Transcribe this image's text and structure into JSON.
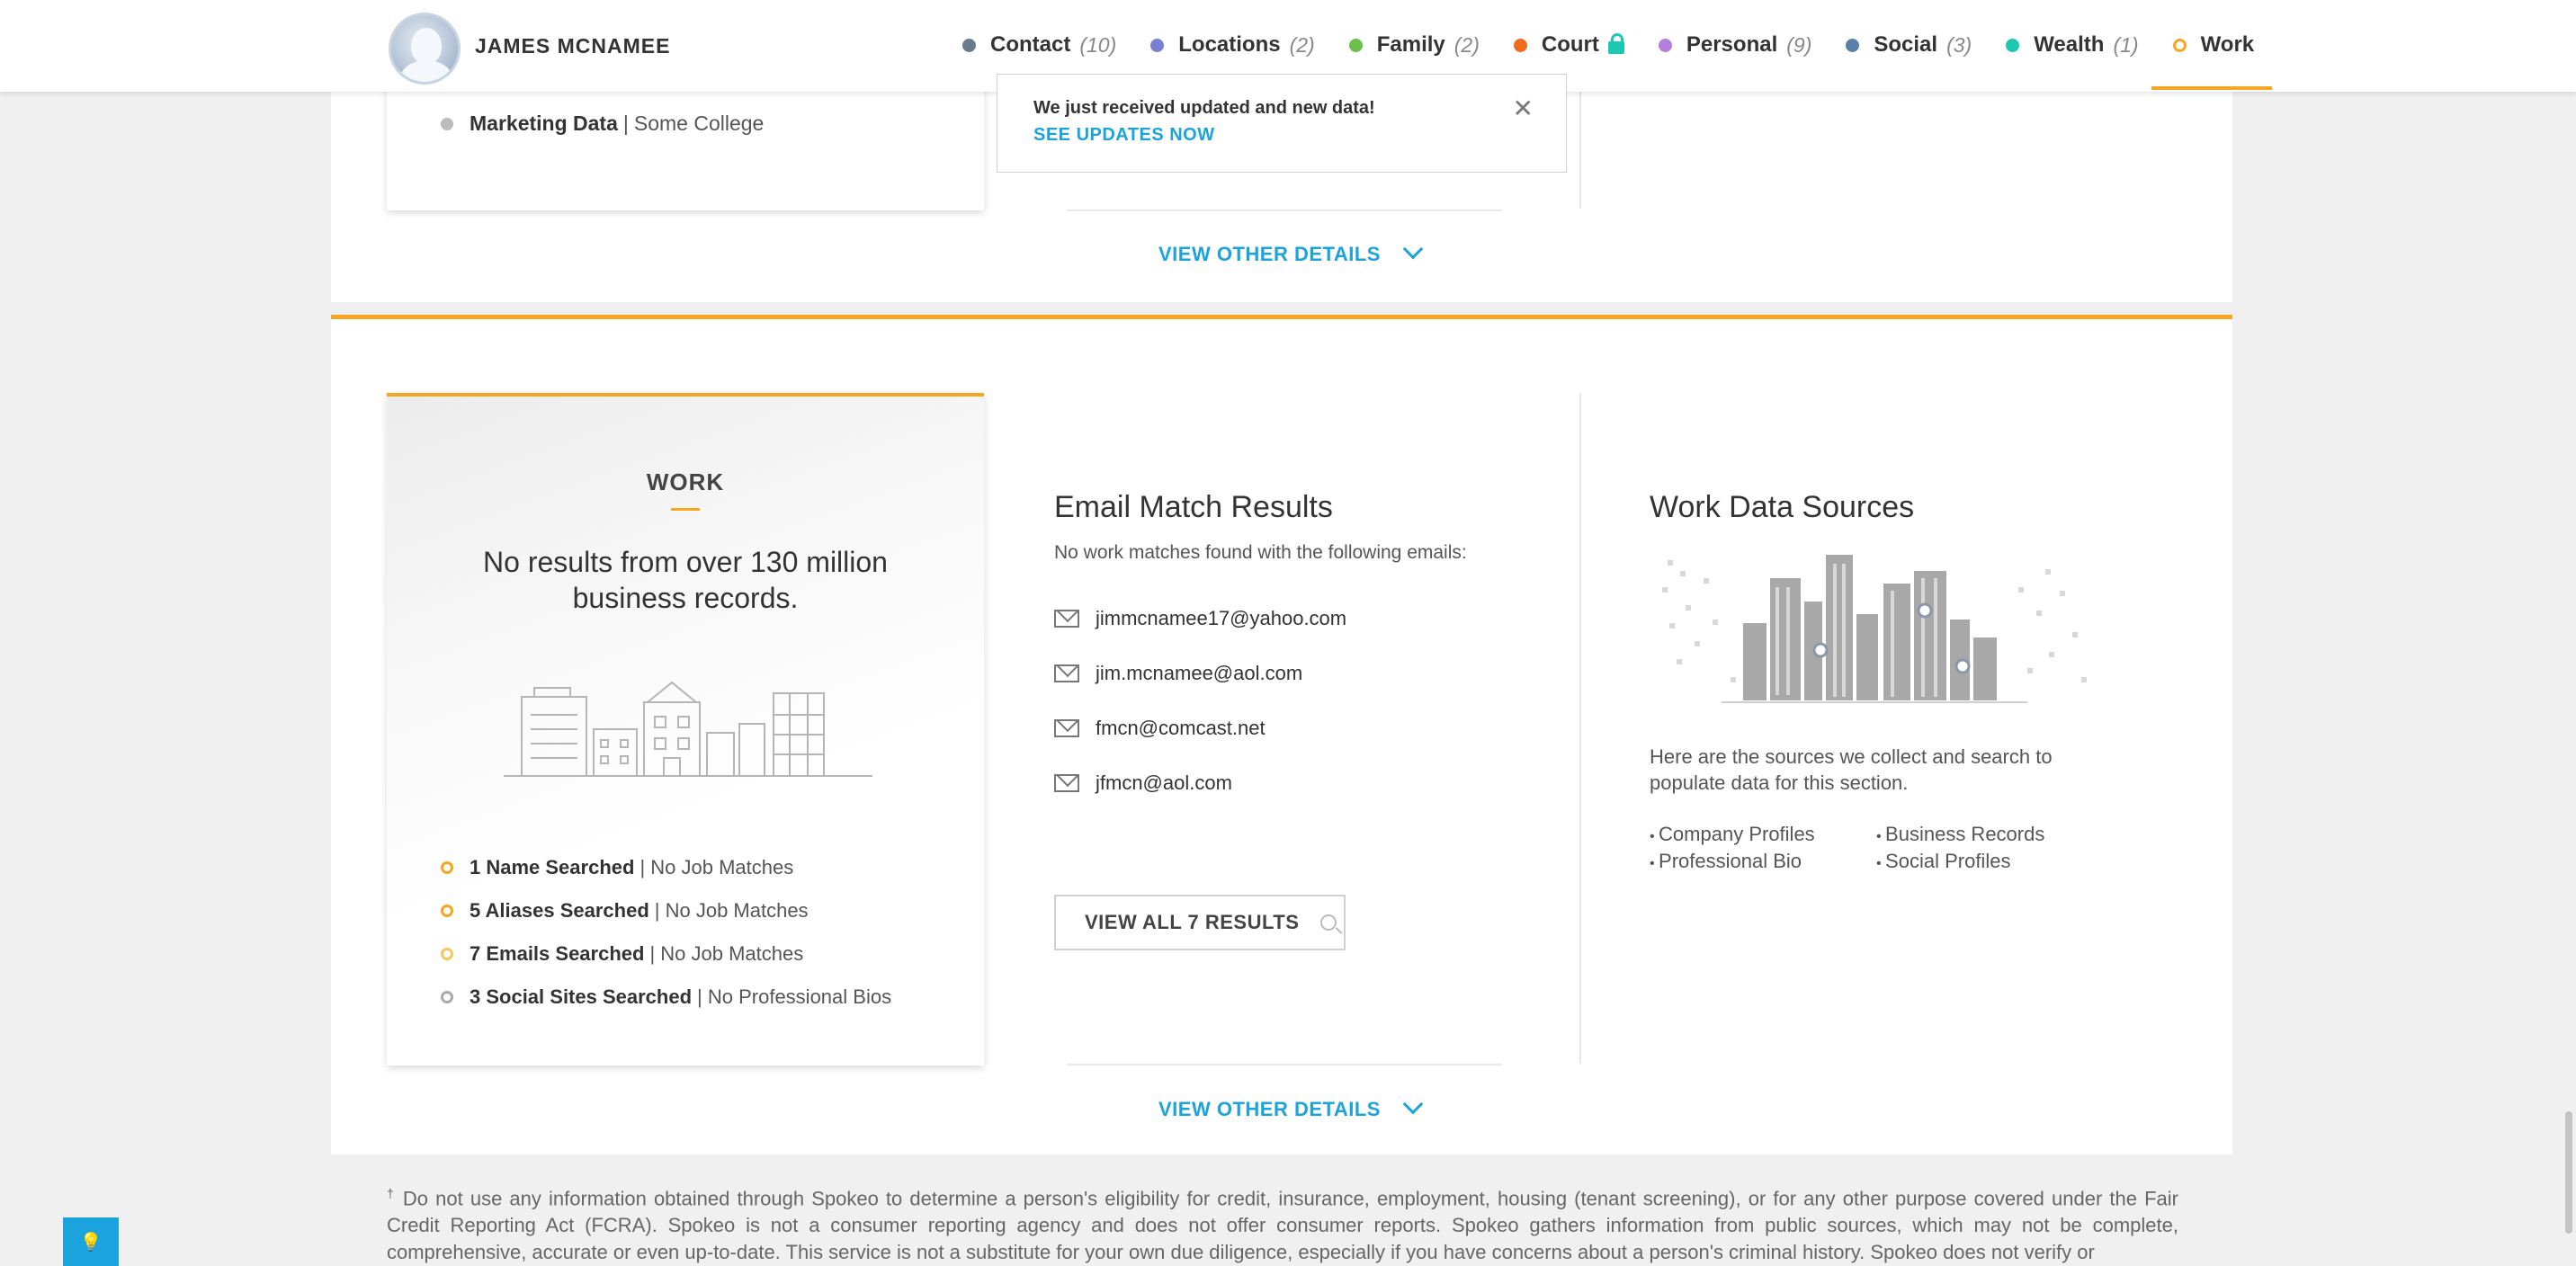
{
  "header": {
    "person_name": "JAMES MCNAMEE",
    "nav": [
      {
        "label": "Contact",
        "count": "(10)",
        "color": "#6b7b8c"
      },
      {
        "label": "Locations",
        "count": "(2)",
        "color": "#7a7fd6"
      },
      {
        "label": "Family",
        "count": "(2)",
        "color": "#6cc04a"
      },
      {
        "label": "Court",
        "count": "",
        "color": "#f26b1d",
        "locked": true
      },
      {
        "label": "Personal",
        "count": "(9)",
        "color": "#b57edc"
      },
      {
        "label": "Social",
        "count": "(3)",
        "color": "#5a7fa8"
      },
      {
        "label": "Wealth",
        "count": "(1)",
        "color": "#1cc8b0"
      },
      {
        "label": "Work",
        "count": "",
        "color": "#f5a623",
        "active": true
      }
    ]
  },
  "notice": {
    "text": "We just received updated and new data!",
    "link": "SEE UPDATES NOW"
  },
  "top_section": {
    "marketing_label": "Marketing Data",
    "marketing_value": "Some College",
    "view_other_details": "VIEW OTHER DETAILS"
  },
  "work": {
    "title": "WORK",
    "message": "No results from over 130 million business records.",
    "searches": [
      {
        "bold": "1 Name Searched",
        "rest": "No Job Matches",
        "color": "#f5a623"
      },
      {
        "bold": "5 Aliases Searched",
        "rest": "No Job Matches",
        "color": "#f5a623"
      },
      {
        "bold": "7 Emails Searched",
        "rest": "No Job Matches",
        "color": "#f7c75a"
      },
      {
        "bold": "3 Social Sites Searched",
        "rest": "No Professional Bios",
        "color": "#aaaaaa"
      }
    ],
    "email_heading": "Email Match Results",
    "email_sub": "No work matches found with the following emails:",
    "emails": [
      "jimmcnamee17@yahoo.com",
      "jim.mcnamee@aol.com",
      "fmcn@comcast.net",
      "jfmcn@aol.com"
    ],
    "view_all_button": "VIEW ALL 7 RESULTS",
    "sources_heading": "Work Data Sources",
    "sources_desc": "Here are the sources we collect and search to populate data for this section.",
    "sources": [
      "Company Profiles",
      "Business Records",
      "Professional Bio",
      "Social Profiles"
    ],
    "view_other_details": "VIEW OTHER DETAILS"
  },
  "disclaimer": {
    "mark": "†",
    "text": " Do not use any information obtained through Spokeo to determine a person's eligibility for credit, insurance, employment, housing (tenant screening), or for any other purpose covered under the Fair Credit Reporting Act (FCRA). Spokeo is not a consumer reporting agency and does not offer consumer reports. Spokeo gathers information from public sources, which may not be complete, comprehensive, accurate or even up-to-date. This service is not a substitute for your own due diligence, especially if you have concerns about a person's criminal history. Spokeo does not verify or"
  }
}
